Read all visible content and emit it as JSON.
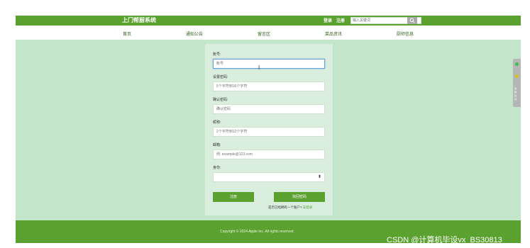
{
  "header": {
    "brand": "上门帮厨系统",
    "login": "登录",
    "register": "注册",
    "search_placeholder": "输入关键词",
    "search_icon": "search-icon",
    "bg_color": "#5aa130"
  },
  "nav": {
    "items": [
      "首页",
      "通知公告",
      "留言区",
      "菜品资讯",
      "厨师信息"
    ]
  },
  "form": {
    "account_label": "账号:",
    "account_placeholder": "账号",
    "password_label": "设置密码:",
    "password_placeholder": "5个字符到16个字符",
    "confirm_label": "确认密码:",
    "confirm_placeholder": "确认密码",
    "nickname_label": "昵称:",
    "nickname_placeholder": "2个字符到12个字符",
    "email_label": "邮箱:",
    "email_placeholder": "例: example@123.com",
    "role_label": "身份:",
    "role_value": "",
    "register_button": "注册",
    "reset_button": "找回密码",
    "has_account_text": "是否已经拥有一个账户?",
    "login_link": "去登录"
  },
  "footer": {
    "copyright": "Copyright © 2024 Apple Inc. All rights reserved."
  },
  "side_widget": {
    "texts": [
      "客",
      "服",
      "热",
      "线"
    ]
  },
  "watermark": "CSDN @计算机毕设vx_BS30813",
  "colors": {
    "accent": "#5aa130",
    "main_bg": "#c3e5c9",
    "card_bg": "#d9eedd"
  }
}
